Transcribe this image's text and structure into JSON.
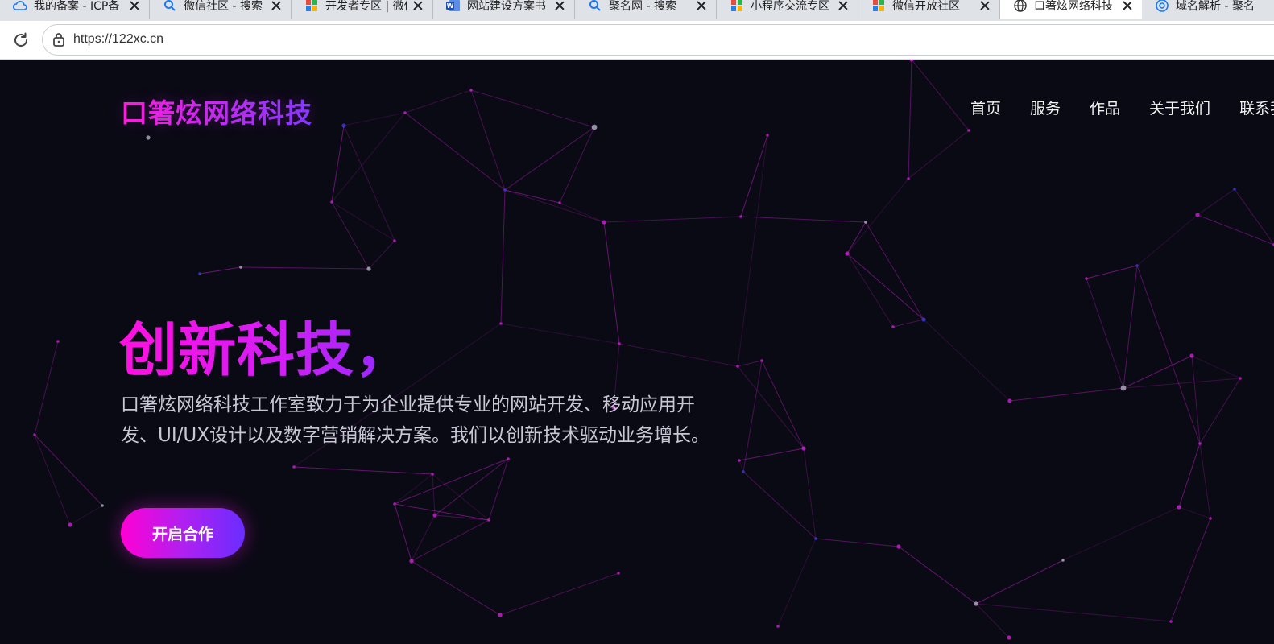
{
  "browser": {
    "tabs": [
      {
        "title": "我的备案 - ICP备",
        "icon": "cloud-icon",
        "active": false
      },
      {
        "title": "微信社区 - 搜索",
        "icon": "search-icon",
        "active": false
      },
      {
        "title": "开发者专区 | 微信",
        "icon": "grid-apps-icon",
        "active": false
      },
      {
        "title": "网站建设方案书",
        "icon": "word-document-icon",
        "active": false
      },
      {
        "title": "聚名网 - 搜索",
        "icon": "search-icon",
        "active": false
      },
      {
        "title": "小程序交流专区",
        "icon": "grid-apps-icon",
        "active": false
      },
      {
        "title": "微信开放社区",
        "icon": "grid-apps-icon",
        "active": false
      },
      {
        "title": "口箸炫网络科技",
        "icon": "globe-icon",
        "active": true
      },
      {
        "title": "域名解析 - 聚名",
        "icon": "domain-icon",
        "active": false
      }
    ],
    "url": "https://122xc.cn"
  },
  "site": {
    "logo": "口箸炫网络科技",
    "nav": [
      "首页",
      "服务",
      "作品",
      "关于我们",
      "联系我们"
    ],
    "hero": {
      "title": "创新科技，",
      "description": "口箸炫网络科技工作室致力于为企业提供专业的网站开发、移动应用开发、UI/UX设计以及数字营销解决方案。我们以创新技术驱动业务增长。",
      "cta_label": "开启合作"
    }
  },
  "colors": {
    "page_background": "#0a0a14",
    "accent_magenta": "#ff10e0",
    "accent_violet": "#7b3bff",
    "network_line": "#c020c8",
    "network_node_grey": "#a8a8b8",
    "network_node_blue": "#3a3ad0"
  }
}
